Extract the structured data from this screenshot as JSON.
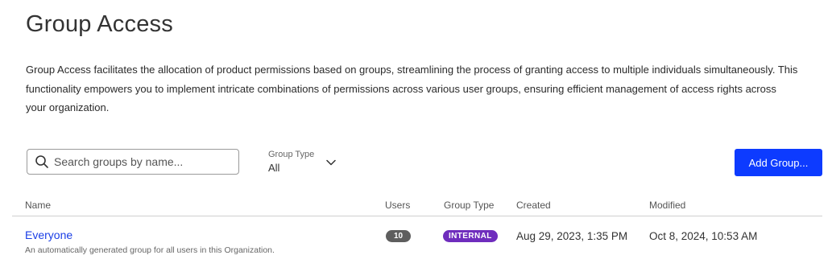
{
  "page": {
    "title": "Group Access",
    "description": "Group Access facilitates the allocation of product permissions based on groups, streamlining the process of granting access to multiple individuals simultaneously. This functionality empowers you to implement intricate combinations of permissions across various user groups, ensuring efficient management of access rights across your organization."
  },
  "toolbar": {
    "search_placeholder": "Search groups by name...",
    "filter_label": "Group Type",
    "filter_value": "All",
    "add_button": "Add Group..."
  },
  "table": {
    "columns": [
      "Name",
      "Users",
      "Group Type",
      "Created",
      "Modified"
    ],
    "rows": [
      {
        "name": "Everyone",
        "description": "An automatically generated group for all users in this Organization.",
        "users": "10",
        "group_type": "INTERNAL",
        "created": "Aug 29, 2023, 1:35 PM",
        "modified": "Oct 8, 2024, 10:53 AM"
      }
    ]
  },
  "colors": {
    "primary_button": "#0d3bff",
    "link": "#1a3ee6",
    "internal_badge": "#6f2dbd",
    "users_badge": "#5e5e5e"
  },
  "icons": [
    "search-icon",
    "chevron-down-icon"
  ]
}
